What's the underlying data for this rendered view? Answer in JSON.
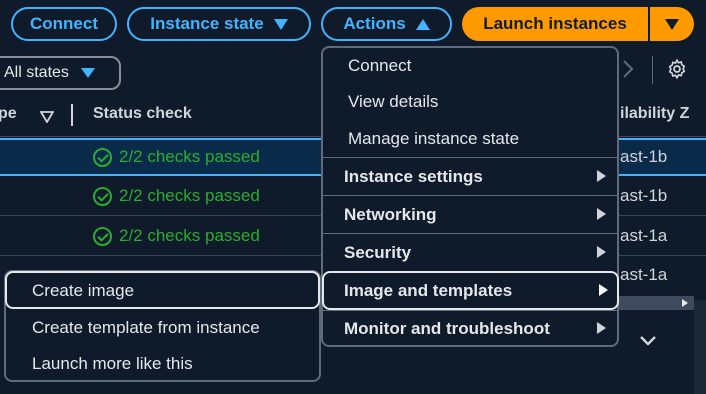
{
  "toolbar": {
    "connect": "Connect",
    "instance_state": "Instance state",
    "actions": "Actions",
    "launch": "Launch instances"
  },
  "filter": {
    "label": "All states"
  },
  "table": {
    "col_type_fragment": "pe",
    "col_status": "Status check",
    "col_az_fragment": "ilability Z",
    "rows": [
      {
        "status": "2/2 checks passed",
        "az": "ast-1b"
      },
      {
        "status": "2/2 checks passed",
        "az": "ast-1b"
      },
      {
        "status": "2/2 checks passed",
        "az": "ast-1a"
      },
      {
        "status": "",
        "az": "ast-1a"
      }
    ]
  },
  "actions_menu": {
    "items": [
      "Connect",
      "View details",
      "Manage instance state"
    ],
    "groups": [
      "Instance settings",
      "Networking",
      "Security",
      "Image and templates",
      "Monitor and troubleshoot"
    ]
  },
  "submenu": {
    "items": [
      "Create image",
      "Create template from instance",
      "Launch more like this"
    ]
  },
  "colors": {
    "accent": "#42b4ff",
    "launch": "#ff9900",
    "success": "#29ad32",
    "background": "#0f1b2a"
  }
}
